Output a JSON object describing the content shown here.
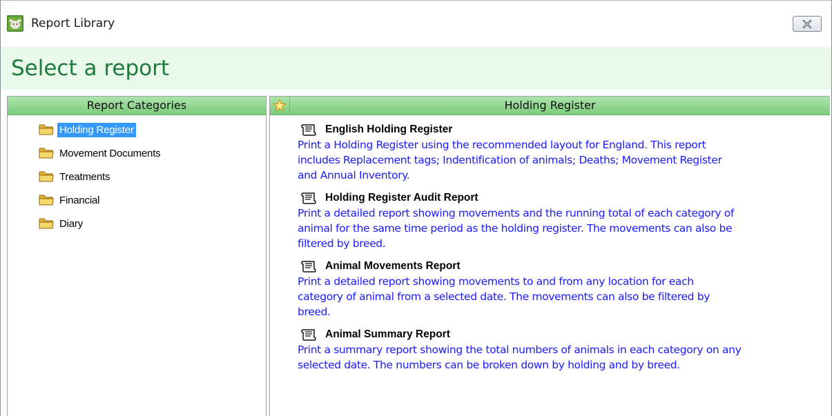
{
  "window": {
    "title": "Report Library",
    "close_icon": "close-icon"
  },
  "banner": {
    "title": "Select a report"
  },
  "categories": {
    "header": "Report Categories",
    "items": [
      {
        "label": "Holding Register",
        "icon": "folder-icon",
        "selected": true
      },
      {
        "label": "Movement Documents",
        "icon": "folder-icon",
        "selected": false
      },
      {
        "label": "Treatments",
        "icon": "folder-icon",
        "selected": false
      },
      {
        "label": "Financial",
        "icon": "folder-icon",
        "selected": false
      },
      {
        "label": "Diary",
        "icon": "folder-icon",
        "selected": false
      }
    ]
  },
  "reports": {
    "header": "Holding Register",
    "favourite_icon": "star-icon",
    "items": [
      {
        "name": "English Holding Register",
        "icon": "scroll-icon",
        "lines": [
          "Print a Holding Register using the recommended layout for England. This report",
          "includes Replacement tags; Indentification of animals; Deaths; Movement Register",
          "and Annual Inventory."
        ]
      },
      {
        "name": "Holding Register Audit Report",
        "icon": "scroll-icon",
        "lines": [
          "Print a detailed report showing movements and the running total of each category of",
          "animal for the same time period as the holding register. The movements can also be",
          "filtered by breed."
        ]
      },
      {
        "name": "Animal Movements Report",
        "icon": "scroll-icon",
        "lines": [
          "Print a detailed report showing movements to and from any location for each",
          "category of animal from a selected date. The movements can also be filtered by",
          "breed."
        ]
      },
      {
        "name": "Animal Summary Report",
        "icon": "scroll-icon",
        "lines": [
          "Print a summary report showing the total numbers of animals in each category on any",
          "selected date. The numbers can be broken down by holding and by breed."
        ]
      }
    ]
  },
  "colors": {
    "banner_bg": "#eafaea",
    "banner_text": "#1e7a3c",
    "header_green": "#7ccc7c",
    "selection": "#3399ff",
    "description_text": "#1a1aff"
  }
}
